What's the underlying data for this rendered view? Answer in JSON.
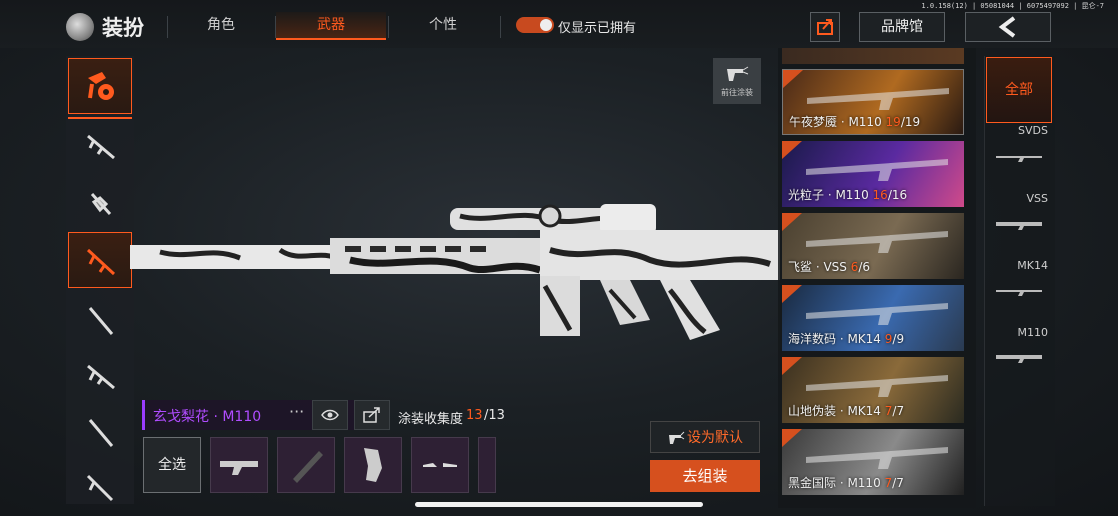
{
  "version": "1.0.158(12) | 05081044 | 6075497092 | 昆仑-7",
  "header": {
    "title": "装扮",
    "tabs": [
      {
        "label": "角色"
      },
      {
        "label": "武器"
      },
      {
        "label": "个性"
      }
    ],
    "active_tab": "武器",
    "toggle_label": "仅显示已拥有",
    "toggle_on": true,
    "brand_button": "品牌馆"
  },
  "left_categories": [
    {
      "icon": "skin-category-icon",
      "active": true
    },
    {
      "icon": "assault-rifle-icon",
      "active": false
    },
    {
      "icon": "smg-icon",
      "active": false
    },
    {
      "icon": "sniper-dmr-icon",
      "active": true
    },
    {
      "icon": "sniper-rifle-icon",
      "active": false
    },
    {
      "icon": "rifle-icon",
      "active": false
    },
    {
      "icon": "shotgun-icon",
      "active": false
    },
    {
      "icon": "lmg-icon",
      "active": false
    }
  ],
  "paint_button": {
    "label": "前往涂装"
  },
  "skin": {
    "name": "玄戈梨花 · M110",
    "more": "···",
    "collection_label": "涂装收集度",
    "collected": "13",
    "total": "/13"
  },
  "parts": {
    "select_all": "全选",
    "slots": 5
  },
  "actions": {
    "set_default": "设为默认",
    "assemble": "去组装"
  },
  "skins_list": [
    {
      "name": "午夜梦魇 · M110 ",
      "owned": "19",
      "total": "/19",
      "colors": [
        "#4a2a18",
        "#b06a20",
        "#2a1a12"
      ]
    },
    {
      "name": "光粒子 · M110 ",
      "owned": "16",
      "total": "/16",
      "colors": [
        "#1a1a4a",
        "#5a2aa0",
        "#d04a8a"
      ]
    },
    {
      "name": "飞鲨 · VSS ",
      "owned": "6",
      "total": "/6",
      "colors": [
        "#4a4030",
        "#7a6a52",
        "#2a2620"
      ]
    },
    {
      "name": "海洋数码 · MK14 ",
      "owned": "9",
      "total": "/9",
      "colors": [
        "#1a2a40",
        "#3a6ab0",
        "#2a3a50"
      ]
    },
    {
      "name": "山地伪装 · MK14 ",
      "owned": "7",
      "total": "/7",
      "colors": [
        "#3a3020",
        "#8a6a3a",
        "#2a2a20"
      ]
    },
    {
      "name": "黑金国际 · M110 ",
      "owned": "7",
      "total": "/7",
      "colors": [
        "#3a3a3a",
        "#8a8a8a",
        "#202020"
      ]
    }
  ],
  "filters": [
    {
      "label": "全部",
      "active": true
    },
    {
      "label": "SVDS"
    },
    {
      "label": "VSS"
    },
    {
      "label": "MK14"
    },
    {
      "label": "M110"
    }
  ],
  "colors": {
    "accent": "#ff5a1e",
    "purple": "#b04cff"
  }
}
